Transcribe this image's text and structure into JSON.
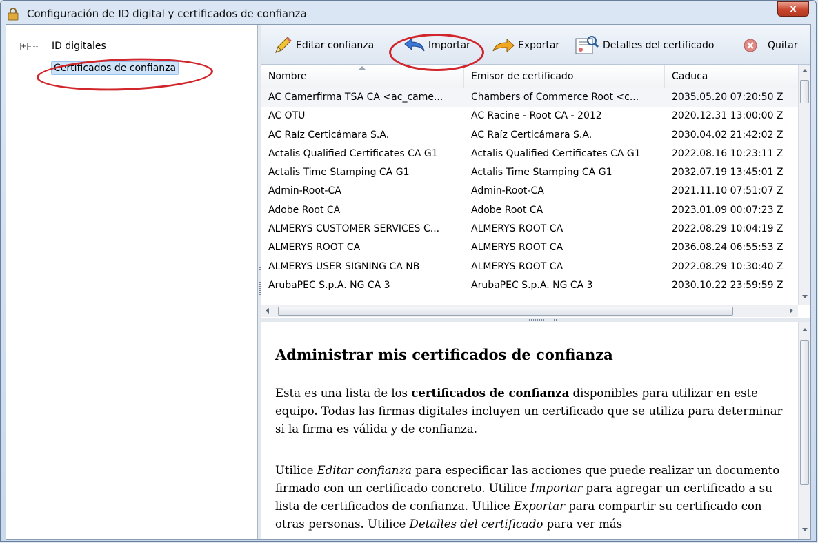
{
  "window": {
    "title": "Configuración de ID digital y certificados de confianza",
    "close_label": "x"
  },
  "tree": {
    "items": [
      {
        "label": "ID digitales",
        "expander": "+"
      },
      {
        "label": "Certificados de confianza",
        "selected": true
      }
    ]
  },
  "toolbar": {
    "edit_label": "Editar confianza",
    "import_label": "Importar",
    "export_label": "Exportar",
    "details_label": "Detalles del certificado",
    "remove_label": "Quitar"
  },
  "table": {
    "columns": [
      "Nombre",
      "Emisor de certificado",
      "Caduca"
    ],
    "rows": [
      [
        "AC Camerfirma TSA CA <ac_came...",
        "Chambers of Commerce Root <c...",
        "2035.05.20 07:20:50 Z"
      ],
      [
        "AC OTU",
        "AC Racine - Root CA - 2012",
        "2020.12.31 13:00:00 Z"
      ],
      [
        "AC Raíz Certicámara S.A.",
        "AC Raíz Certicámara S.A.",
        "2030.04.02 21:42:02 Z"
      ],
      [
        "Actalis Qualified Certificates CA G1",
        "Actalis Qualified Certificates CA G1",
        "2022.08.16 10:23:11 Z"
      ],
      [
        "Actalis Time Stamping CA G1",
        "Actalis Time Stamping CA G1",
        "2032.07.19 13:45:01 Z"
      ],
      [
        "Admin-Root-CA",
        "Admin-Root-CA",
        "2021.11.10 07:51:07 Z"
      ],
      [
        "Adobe Root CA",
        "Adobe Root CA",
        "2023.01.09 00:07:23 Z"
      ],
      [
        "ALMERYS CUSTOMER SERVICES C...",
        "ALMERYS ROOT CA",
        "2022.08.29 10:04:19 Z"
      ],
      [
        "ALMERYS ROOT CA",
        "ALMERYS ROOT CA",
        "2036.08.24 06:55:53 Z"
      ],
      [
        "ALMERYS USER SIGNING CA NB",
        "ALMERYS ROOT CA",
        "2022.08.29 10:30:40 Z"
      ],
      [
        "ArubaPEC S.p.A. NG CA 3",
        "ArubaPEC S.p.A. NG CA 3",
        "2030.10.22 23:59:59 Z"
      ]
    ]
  },
  "description": {
    "heading": "Administrar mis certificados de confianza",
    "p1": [
      {
        "t": "Esta es una lista de los "
      },
      {
        "t": "certificados de confianza",
        "b": true
      },
      {
        "t": " disponibles para utilizar en este equipo. Todas las firmas digitales incluyen un certificado que se utiliza para determinar si la firma es válida y de confianza."
      }
    ],
    "p2": [
      {
        "t": "Utilice "
      },
      {
        "t": "Editar confianza",
        "i": true
      },
      {
        "t": " para especificar las acciones que puede realizar un documento firmado con un certificado concreto. Utilice "
      },
      {
        "t": "Importar",
        "i": true
      },
      {
        "t": " para agregar un certificado a su lista de certificados de confianza. Utilice "
      },
      {
        "t": "Exportar",
        "i": true
      },
      {
        "t": " para compartir su certificado con otras personas. Utilice "
      },
      {
        "t": "Detalles del certificado",
        "i": true
      },
      {
        "t": " para ver más"
      }
    ]
  },
  "colors": {
    "annotation": "#d1262b",
    "selection": "#cde3f8",
    "close_button": "#c9452d"
  }
}
